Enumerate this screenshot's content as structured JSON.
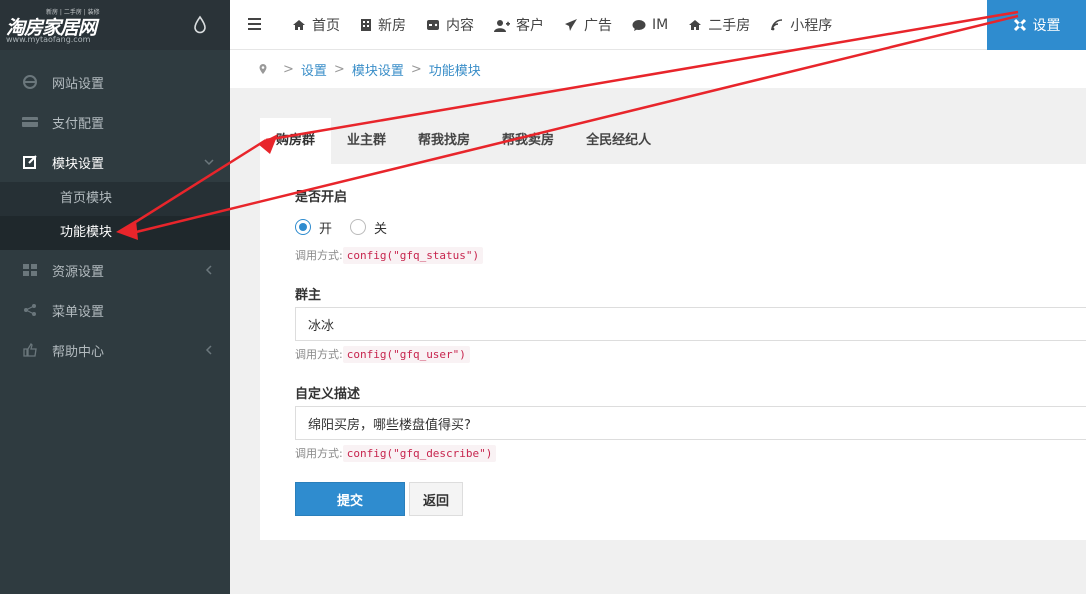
{
  "brand": {
    "name": "淘房家居网",
    "tagline": "新房 | 二手房 | 装修",
    "url": "www.mytaofang.com"
  },
  "sidebar": {
    "items": [
      {
        "label": "网站设置",
        "icon": "ie-icon"
      },
      {
        "label": "支付配置",
        "icon": "card-icon"
      },
      {
        "label": "模块设置",
        "icon": "edit-icon",
        "active": true,
        "children": [
          {
            "label": "首页模块"
          },
          {
            "label": "功能模块",
            "current": true
          }
        ]
      },
      {
        "label": "资源设置",
        "icon": "grid-icon"
      },
      {
        "label": "菜单设置",
        "icon": "share-icon"
      },
      {
        "label": "帮助中心",
        "icon": "thumb-icon"
      }
    ]
  },
  "topnav": {
    "items": [
      {
        "label": "首页",
        "icon": "home-icon"
      },
      {
        "label": "新房",
        "icon": "building-icon"
      },
      {
        "label": "内容",
        "icon": "gamepad-icon"
      },
      {
        "label": "客户",
        "icon": "user-plus-icon"
      },
      {
        "label": "广告",
        "icon": "paper-plane-icon"
      },
      {
        "label": "IM",
        "icon": "comment-icon"
      },
      {
        "label": "二手房",
        "icon": "home-icon"
      },
      {
        "label": "小程序",
        "icon": "wifi-icon"
      },
      {
        "label": "设置",
        "icon": "joomla-icon",
        "active": true
      }
    ]
  },
  "breadcrumb": [
    "设置",
    "模块设置",
    "功能模块"
  ],
  "tabs": [
    "购房群",
    "业主群",
    "帮我找房",
    "帮我卖房",
    "全民经纪人"
  ],
  "form": {
    "status": {
      "label": "是否开启",
      "options": [
        "开",
        "关"
      ],
      "selected": "开",
      "hint_prefix": "调用方式:",
      "hint_code": "config(\"gfq_status\")"
    },
    "owner": {
      "label": "群主",
      "value": "冰冰",
      "hint_prefix": "调用方式:",
      "hint_code": "config(\"gfq_user\")"
    },
    "describe": {
      "label": "自定义描述",
      "value": "绵阳买房，哪些楼盘值得买?",
      "hint_prefix": "调用方式:",
      "hint_code": "config(\"gfq_describe\")"
    },
    "submit_label": "提交",
    "back_label": "返回"
  },
  "colors": {
    "accent": "#2f8ccf",
    "sidebar_bg": "#2f3b40",
    "annotation_arrow": "#e8252b"
  }
}
